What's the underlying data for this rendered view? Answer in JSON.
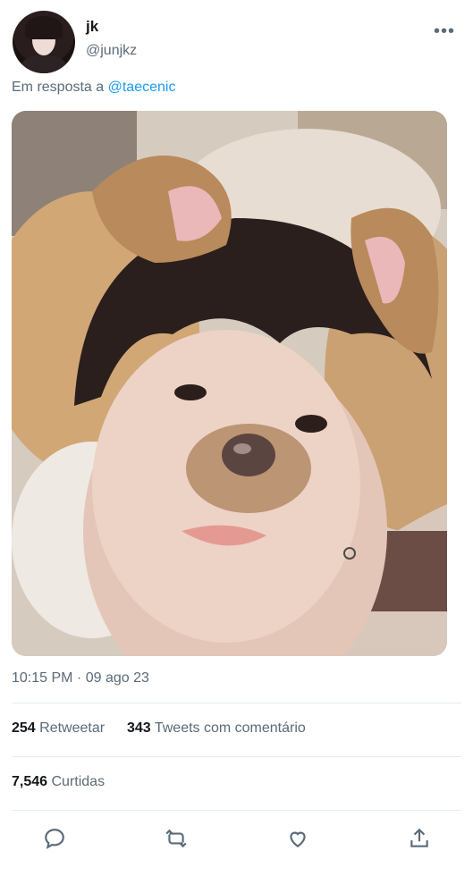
{
  "tweet": {
    "author_name": "jk",
    "author_handle": "@junjkz",
    "reply_prefix": "Em resposta a",
    "reply_mention": "@taecenic",
    "timestamp": "10:15 PM · 09 ago 23",
    "retweets_count": "254",
    "retweets_label": "Retweetar",
    "quote_count": "343",
    "quote_label": "Tweets com comentário",
    "likes_count": "7,546",
    "likes_label": "Curtidas"
  },
  "icons": {
    "more": "more-options-icon",
    "reply": "reply-icon",
    "retweet": "retweet-icon",
    "like": "heart-icon",
    "share": "share-icon"
  },
  "colors": {
    "link": "#1d9bf0",
    "muted": "#5b6b78",
    "text": "#14171a"
  }
}
